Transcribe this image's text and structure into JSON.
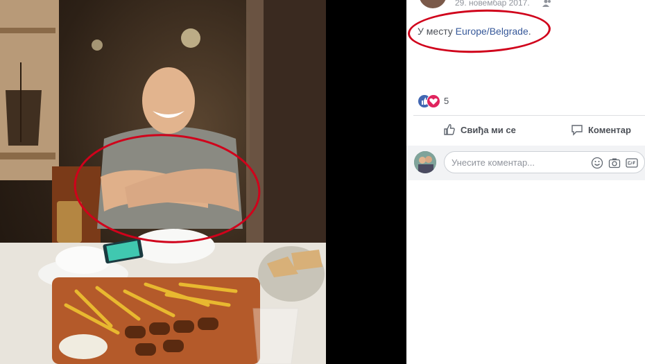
{
  "post": {
    "date": "29. новембар 2017.",
    "location_prefix": "У месту ",
    "location_place": "Europe/Belgrade",
    "location_suffix": ".",
    "reaction_count": "5"
  },
  "actions": {
    "like_label": "Свиђа ми се",
    "comment_label": "Коментар"
  },
  "comment_box": {
    "placeholder": "Унесите коментар..."
  },
  "icons": {
    "privacy": "friends-icon",
    "like": "thumbs-up-icon",
    "comment": "speech-bubble-icon",
    "emoji": "smiley-icon",
    "camera": "camera-icon",
    "gif": "gif-icon"
  },
  "colors": {
    "annotation_red": "#d0021b",
    "facebook_blue": "#4267b2",
    "link_blue": "#365899",
    "love_red": "#e0245e"
  }
}
